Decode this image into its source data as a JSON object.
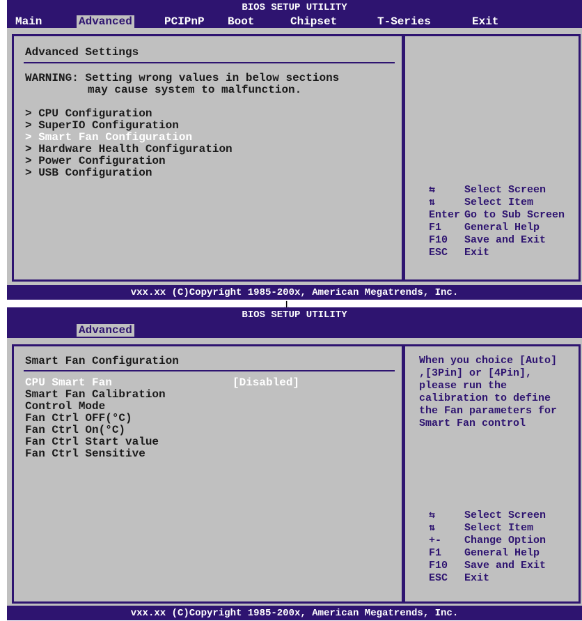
{
  "screen1": {
    "bios_title": "BIOS SETUP UTILITY",
    "menu": [
      "Main",
      "Advanced",
      "PCIPnP",
      "Boot",
      "Chipset",
      "T-Series",
      "Exit"
    ],
    "active_menu": "Advanced",
    "section_title": "Advanced Settings",
    "warning_line1": "WARNING: Setting wrong values in below sections",
    "warning_line2": "may cause system to malfunction.",
    "items": [
      "> CPU Configuration",
      "> SuperIO Configuration",
      "> Smart Fan Configuration",
      "> Hardware Health Configuration",
      "> Power Configuration",
      "> USB Configuration"
    ],
    "selected_item": "> Smart Fan Configuration",
    "help_keys": [
      {
        "key": "",
        "icon": "left-right-arrows-icon",
        "desc": "Select Screen"
      },
      {
        "key": "",
        "icon": "up-down-arrows-icon",
        "desc": "Select Item"
      },
      {
        "key": "Enter",
        "desc": "Go to Sub Screen"
      },
      {
        "key": "F1",
        "desc": "General Help"
      },
      {
        "key": "F10",
        "desc": "Save and Exit"
      },
      {
        "key": "ESC",
        "desc": "Exit"
      }
    ],
    "footer": "vxx.xx (C)Copyright 1985-200x, American Megatrends, Inc."
  },
  "arrow": "↓",
  "screen2": {
    "bios_title": "BIOS SETUP UTILITY",
    "active_menu": "Advanced",
    "section_title": "Smart Fan Configuration",
    "items": [
      {
        "label": "CPU Smart Fan",
        "value": "[Disabled]"
      },
      {
        "label": "Smart Fan Calibration",
        "value": ""
      },
      {
        "label": "Control Mode",
        "value": ""
      },
      {
        "label": "Fan Ctrl OFF(°C)",
        "value": ""
      },
      {
        "label": "Fan Ctrl On(°C)",
        "value": ""
      },
      {
        "label": "Fan Ctrl Start value",
        "value": ""
      },
      {
        "label": "Fan Ctrl Sensitive",
        "value": ""
      }
    ],
    "help_text": [
      "When you choice [Auto]",
      ",[3Pin] or [4Pin],",
      "please run the",
      "calibration to define",
      "the Fan parameters for",
      "Smart Fan control"
    ],
    "help_keys": [
      {
        "key": "",
        "icon": "left-right-arrows-icon",
        "desc": "Select Screen"
      },
      {
        "key": "",
        "icon": "up-down-arrows-icon",
        "desc": "Select Item"
      },
      {
        "key": "+-",
        "desc": "Change Option"
      },
      {
        "key": "F1",
        "desc": "General Help"
      },
      {
        "key": "F10",
        "desc": "Save and Exit"
      },
      {
        "key": "ESC",
        "desc": "Exit"
      }
    ],
    "footer": "vxx.xx (C)Copyright 1985-200x, American Megatrends, Inc."
  },
  "colors": {
    "bar": "#2e1470",
    "panel": "#c0c0c0",
    "text": "#1a1a1a",
    "highlight": "#ffffff"
  }
}
